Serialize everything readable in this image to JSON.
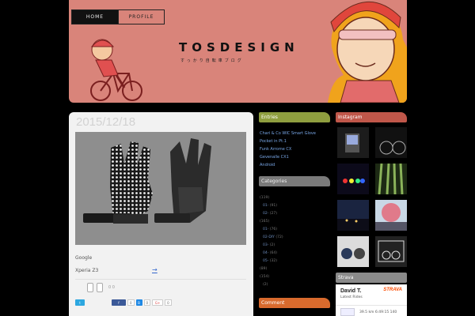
{
  "nav": {
    "home": "HOME",
    "profile": "PROFILE"
  },
  "site": {
    "title": "TOSDESIGN",
    "subtitle": "すっかり自転車ブログ"
  },
  "post": {
    "date": "2015/12/18",
    "line1": "Google",
    "line2": "Xperia Z3",
    "link": "→",
    "like_counts": "0  0",
    "share": {
      "fb_count": "0",
      "b_count": "0",
      "g_count": "0"
    }
  },
  "sidebar": {
    "entries_title": "Entries",
    "entries": [
      "Chari & Co WIC Smart Glove",
      "Pocket in  Pt.1",
      "Funk Arrome CX",
      "Gevenalle CX1",
      "Android"
    ],
    "categories_title": "Categories",
    "categories": [
      {
        "label": "",
        "count": "(119)",
        "indent": false
      },
      {
        "label": "01-",
        "count": "(91)",
        "indent": true
      },
      {
        "label": "02-",
        "count": "(27)",
        "indent": true
      },
      {
        "label": "",
        "count": "(165)",
        "indent": false
      },
      {
        "label": "01-",
        "count": "(76)",
        "indent": true
      },
      {
        "label": "02-DIY",
        "count": "(72)",
        "indent": true
      },
      {
        "label": "03-",
        "count": "(2)",
        "indent": true
      },
      {
        "label": "04-",
        "count": "(64)",
        "indent": true
      },
      {
        "label": "05-",
        "count": "(32)",
        "indent": true
      },
      {
        "label": "",
        "count": "(89)",
        "indent": false
      },
      {
        "label": "",
        "count": "(154)",
        "indent": false
      },
      {
        "label": "",
        "count": "(2)",
        "indent": true
      }
    ],
    "comment_title": "Comment"
  },
  "right": {
    "instagram_title": "Instagram",
    "strava_title": "Strava",
    "strava": {
      "name": "David T.",
      "sub": "Latest Rides",
      "logo": "STRAVA",
      "ride": "39.5 km   6:49:15   140"
    }
  },
  "colors": {
    "header_bg": "#d9847a",
    "entries": "#8f9e3f",
    "categories": "#7a7a7a",
    "comment": "#d86a2d",
    "instagram": "#c0574a",
    "strava": "#fc4c02"
  }
}
